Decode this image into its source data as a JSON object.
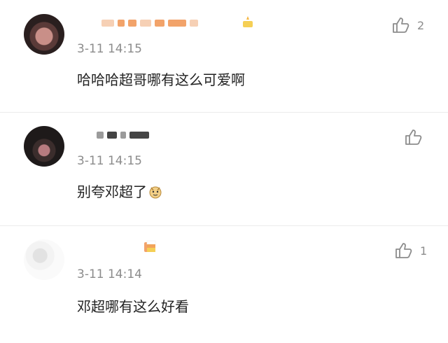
{
  "comments": [
    {
      "time": "3-11 14:15",
      "text": "哈哈哈超哥哪有这么可爱啊",
      "likes": "2",
      "emoji_name": "sparkle-badge-icon"
    },
    {
      "time": "3-11 14:15",
      "text": "别夸邓超了",
      "likes": "",
      "emoji_name": "doge-face-icon"
    },
    {
      "time": "3-11 14:14",
      "text": "邓超哪有这么好看",
      "likes": "1",
      "emoji_name": "candy-corn-icon"
    }
  ],
  "colors": {
    "text": "#222222",
    "meta": "#8c8c8c",
    "divider": "#ececec"
  }
}
